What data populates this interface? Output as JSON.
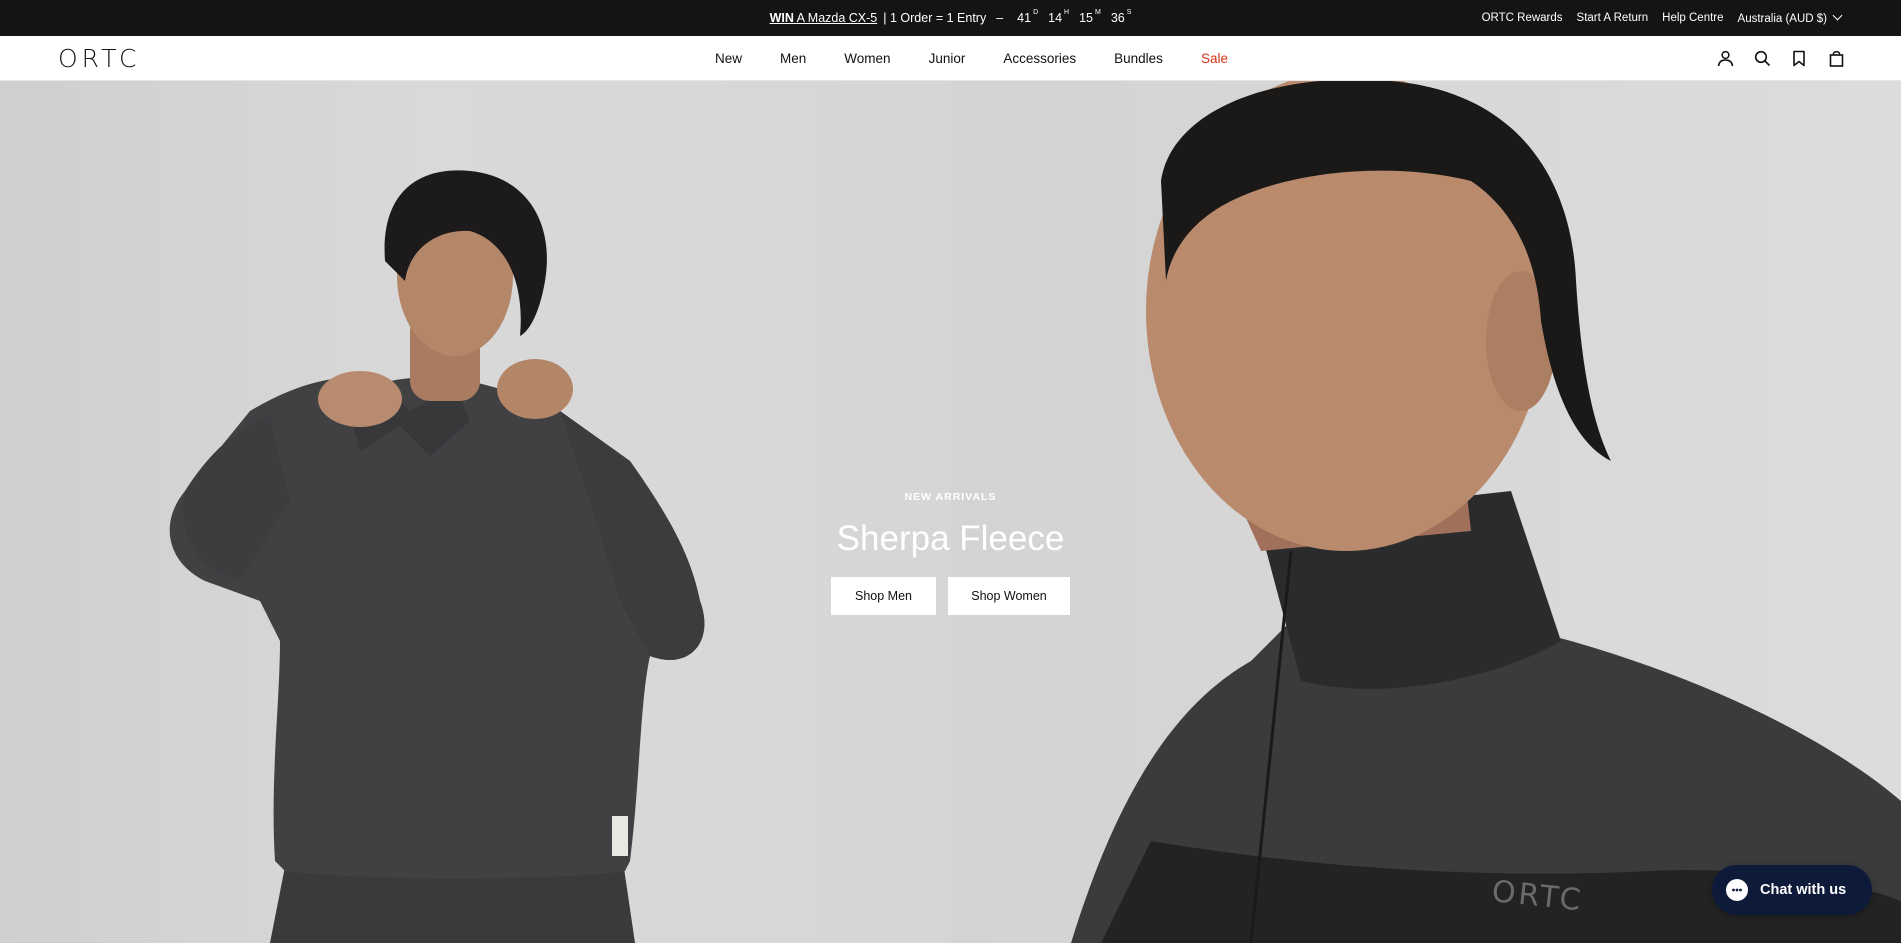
{
  "announcement": {
    "win": "WIN",
    "prize": "A Mazda CX-5",
    "entry_text": "| 1 Order = 1 Entry",
    "dash": "–",
    "countdown": [
      {
        "num": "41",
        "sfx": "D"
      },
      {
        "num": "14",
        "sfx": "H"
      },
      {
        "num": "15",
        "sfx": "M"
      },
      {
        "num": "36",
        "sfx": "S"
      }
    ],
    "utility_links": [
      "ORTC Rewards",
      "Start A Return",
      "Help Centre"
    ],
    "region": "Australia (AUD $)"
  },
  "header": {
    "logo": "ORTC",
    "nav": [
      "New",
      "Men",
      "Women",
      "Junior",
      "Accessories",
      "Bundles",
      "Sale"
    ],
    "sale_color": "#d4351c",
    "icons": [
      "account-icon",
      "search-icon",
      "wishlist-icon",
      "bag-icon"
    ]
  },
  "hero": {
    "eyebrow": "NEW ARRIVALS",
    "headline": "Sherpa Fleece",
    "cta_men": "Shop Men",
    "cta_women": "Shop Women",
    "jacket_logo": "ORTC"
  },
  "chat": {
    "label": "Chat with us",
    "bg_color": "#0e1a3a"
  }
}
